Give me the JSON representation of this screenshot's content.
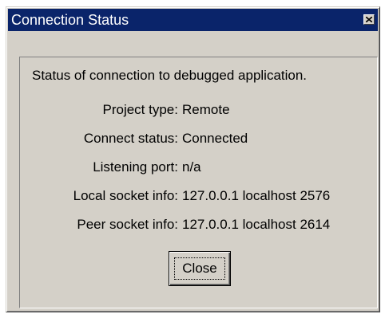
{
  "window": {
    "title": "Connection Status",
    "close_icon": "close-x-icon"
  },
  "dialog": {
    "heading": "Status of connection to debugged application.",
    "rows": [
      {
        "label": "Project type:",
        "value": "Remote"
      },
      {
        "label": "Connect status:",
        "value": "Connected"
      },
      {
        "label": "Listening port:",
        "value": "n/a"
      },
      {
        "label": "Local socket info:",
        "value": "127.0.0.1 localhost 2576"
      },
      {
        "label": "Peer socket info:",
        "value": "127.0.0.1 localhost 2614"
      }
    ],
    "close_label": "Close"
  },
  "colors": {
    "titlebar": "#0a246a",
    "face": "#d4d0c8"
  }
}
